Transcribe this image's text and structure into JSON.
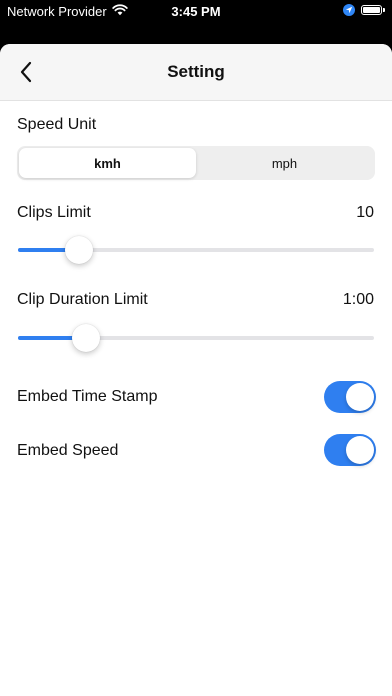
{
  "status_bar": {
    "carrier": "Network Provider",
    "time": "3:45 PM",
    "wifi_icon": "wifi-icon",
    "location_icon": "location-arrow-icon",
    "battery_icon": "battery-icon",
    "battery_level": 1.0
  },
  "navbar": {
    "back_icon": "chevron-left-icon",
    "title": "Setting"
  },
  "settings": {
    "speed_unit": {
      "label": "Speed Unit",
      "options": [
        "kmh",
        "mph"
      ],
      "selected": "kmh"
    },
    "clips_limit": {
      "label": "Clips Limit",
      "value": "10",
      "slider_fraction": 0.17
    },
    "clip_duration_limit": {
      "label": "Clip Duration Limit",
      "value": "1:00",
      "slider_fraction": 0.19
    },
    "embed_time_stamp": {
      "label": "Embed Time Stamp",
      "on": true
    },
    "embed_speed": {
      "label": "Embed Speed",
      "on": true
    }
  },
  "colors": {
    "accent": "#2F7FF0",
    "background": "#FFFFFF",
    "navbar_background": "#F6F6F6",
    "status_bar_background": "#000000"
  }
}
